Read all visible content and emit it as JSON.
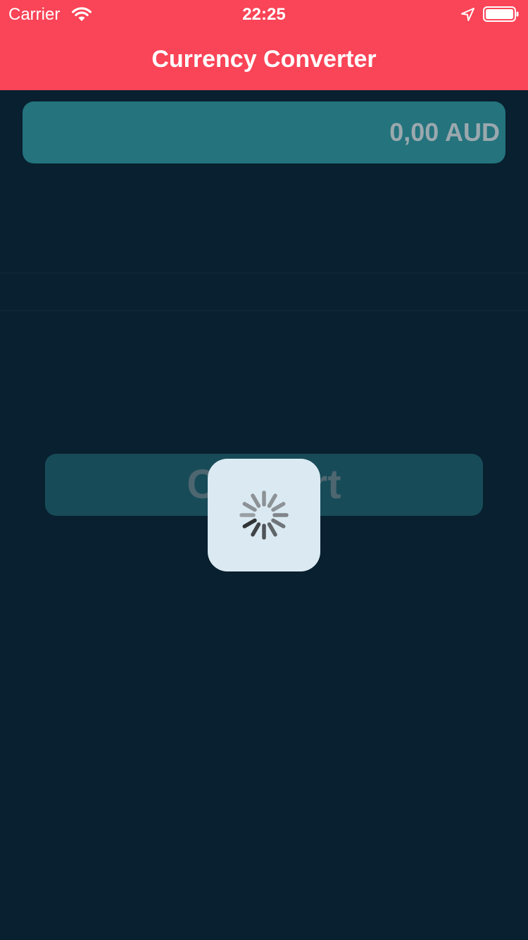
{
  "status_bar": {
    "carrier": "Carrier",
    "time": "22:25",
    "icons": [
      "wifi-icon",
      "location-arrow-icon",
      "battery-icon"
    ]
  },
  "header": {
    "title": "Currency Converter",
    "background_color": "#fa4457"
  },
  "amount_field": {
    "value": "0,00 AUD"
  },
  "convert_button": {
    "label": "Convert"
  },
  "loading_hud": {
    "icon": "activity-spinner-icon"
  },
  "colors": {
    "background": "#08202f",
    "field": "#24737d",
    "button": "#184b58",
    "hud": "#dbeaf2"
  }
}
